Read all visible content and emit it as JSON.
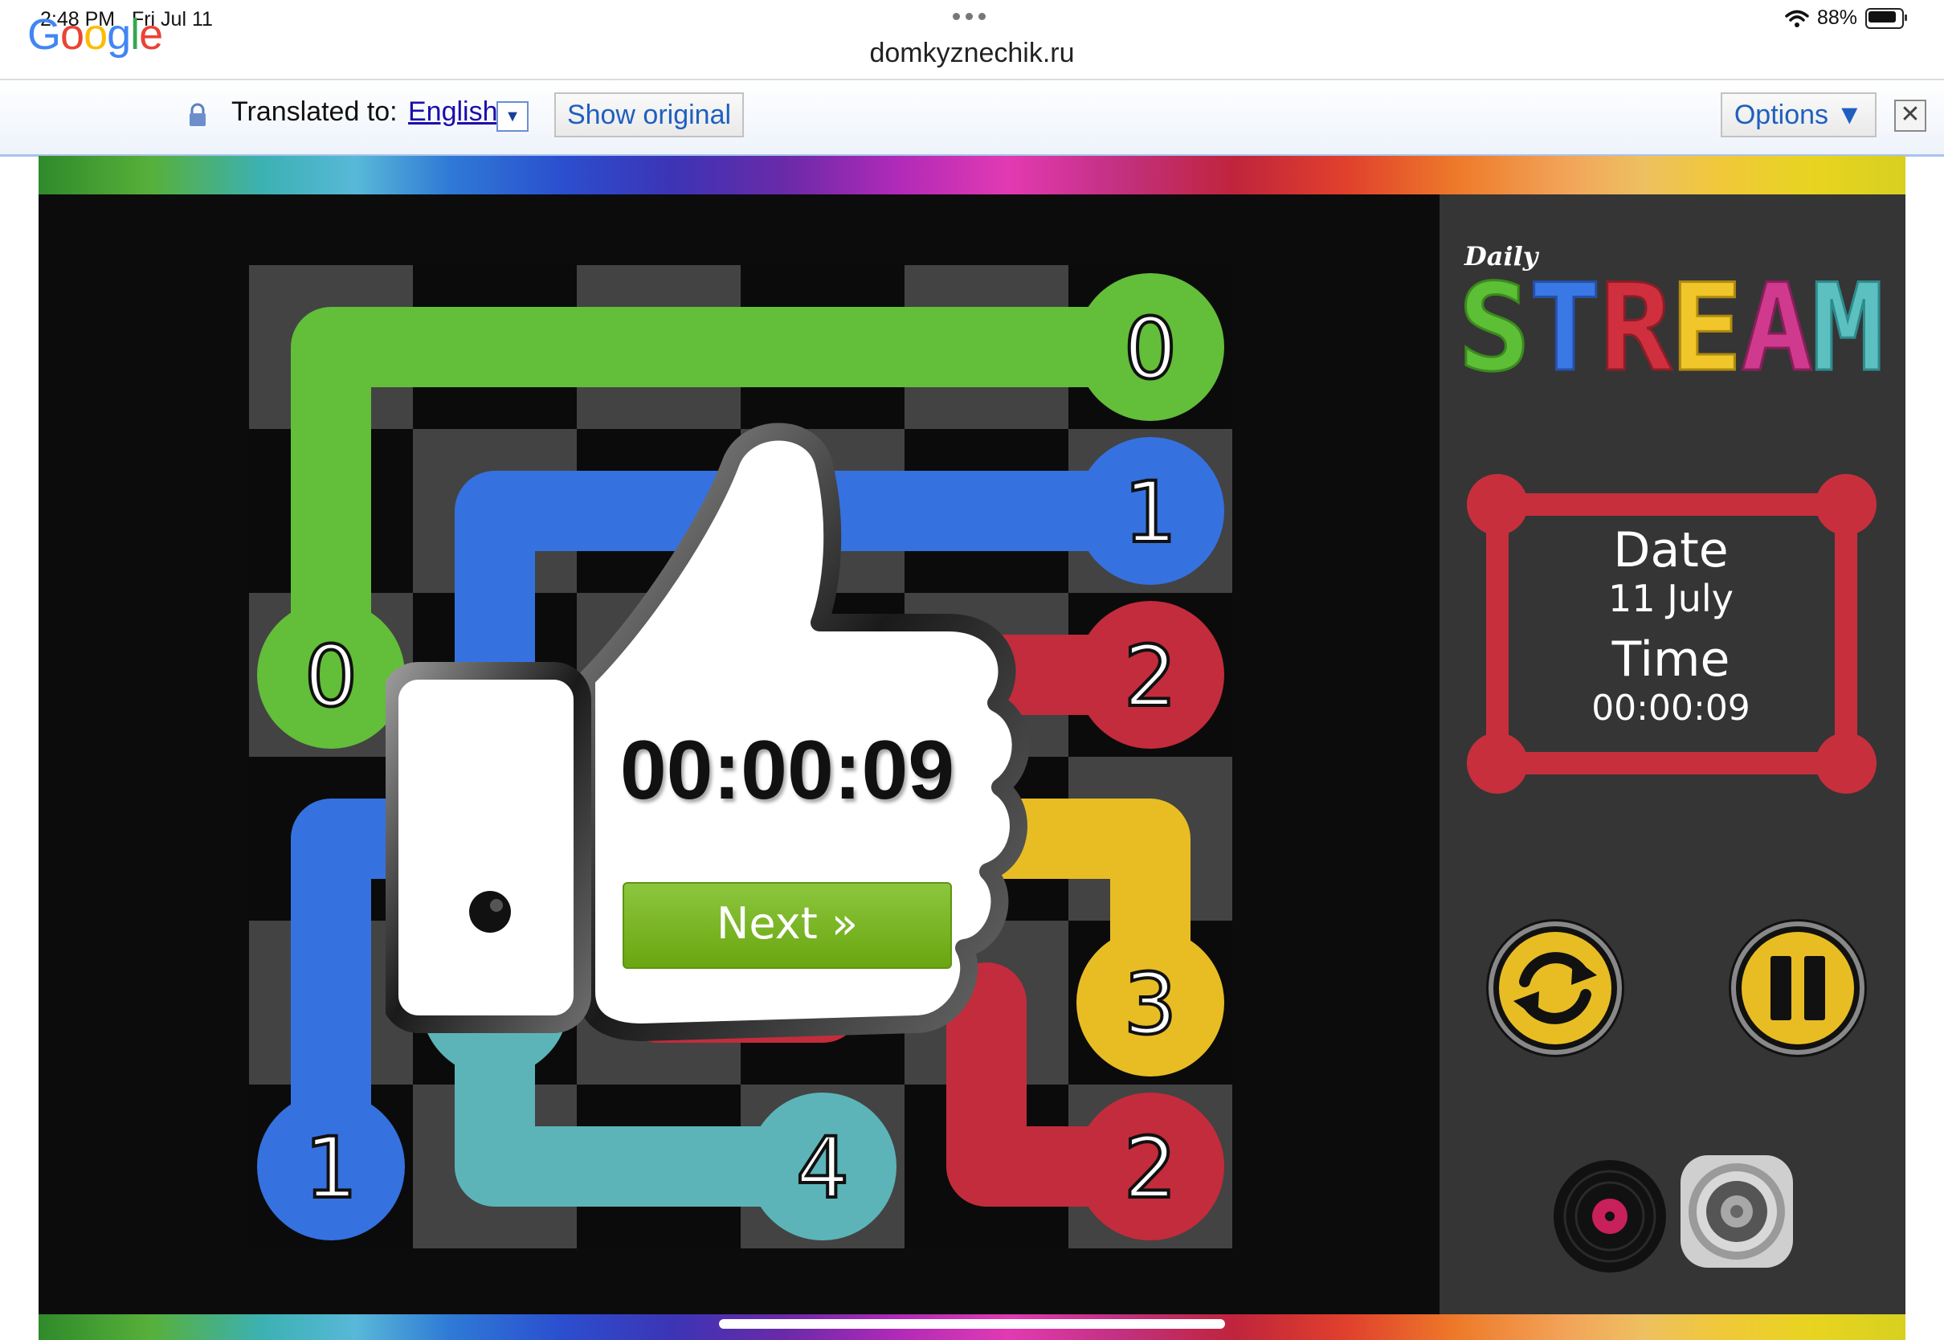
{
  "status_bar": {
    "time": "2:48 PM",
    "date": "Fri Jul 11",
    "battery": "88%"
  },
  "browser": {
    "url": "domkyznechik.ru"
  },
  "translate_bar": {
    "logo": "Google",
    "translated_to_label": "Translated to:",
    "language": "English",
    "show_original_label": "Show original",
    "options_label": "Options ▼",
    "close_label": "✕"
  },
  "game": {
    "title_small": "Daily",
    "title": "STREAM",
    "date_label": "Date",
    "date_value": "11 July",
    "time_label": "Time",
    "time_value": "00:00:09",
    "complete_time": "00:00:09",
    "next_label": "Next »",
    "grid": {
      "rows": 6,
      "cols": 6
    },
    "endpoints": [
      {
        "label": "0",
        "row": 0,
        "col": 5,
        "color": "green"
      },
      {
        "label": "0",
        "row": 2,
        "col": 0,
        "color": "green"
      },
      {
        "label": "1",
        "row": 1,
        "col": 5,
        "color": "blue"
      },
      {
        "label": "1",
        "row": 5,
        "col": 0,
        "color": "blue"
      },
      {
        "label": "2",
        "row": 2,
        "col": 5,
        "color": "red"
      },
      {
        "label": "2",
        "row": 5,
        "col": 5,
        "color": "red"
      },
      {
        "label": "3",
        "row": 4,
        "col": 5,
        "color": "yellow"
      },
      {
        "label": "4",
        "row": 5,
        "col": 3,
        "color": "teal"
      }
    ],
    "colors": {
      "green": "#63be3a",
      "blue": "#3572e0",
      "red": "#c32c3c",
      "yellow": "#e8bd24",
      "teal": "#5cb4b8",
      "board_dark": "#0b0b0b",
      "board_light": "#434343",
      "side_panel": "#353535"
    },
    "controls": {
      "restart_icon": "refresh-icon",
      "pause_icon": "pause-icon",
      "music_icon": "record-icon",
      "sound_icon": "speaker-icon"
    }
  }
}
